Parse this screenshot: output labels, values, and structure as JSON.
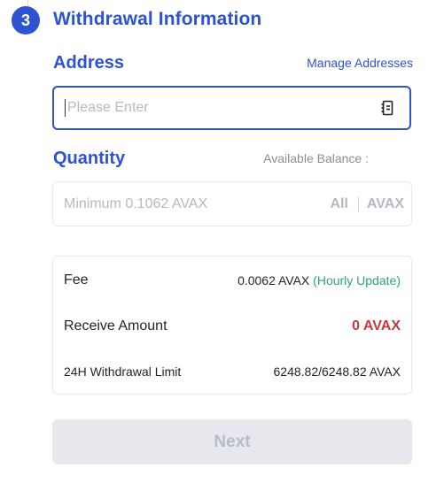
{
  "step": {
    "number": "3",
    "title": "Withdrawal Information"
  },
  "address": {
    "label": "Address",
    "manage_link": "Manage Addresses",
    "placeholder": "Please Enter",
    "value": "",
    "icon": "address-book-icon"
  },
  "quantity": {
    "label": "Quantity",
    "available_balance_label": "Available Balance :",
    "placeholder": "Minimum 0.1062 AVAX",
    "value": "",
    "all_label": "All",
    "unit": "AVAX"
  },
  "summary": {
    "fee": {
      "label": "Fee",
      "value": "0.0062 AVAX",
      "note": "(Hourly Update)"
    },
    "receive": {
      "label": "Receive Amount",
      "value": "0 AVAX"
    },
    "limit": {
      "label": "24H Withdrawal Limit",
      "value": "6248.82/6248.82 AVAX"
    }
  },
  "actions": {
    "next_label": "Next"
  },
  "colors": {
    "accent": "#2d52d2",
    "fee_note": "#2ea37a",
    "receive_amount": "#c8373b",
    "disabled_bg": "#e7e8ed",
    "disabled_text": "#b8bcc5"
  }
}
